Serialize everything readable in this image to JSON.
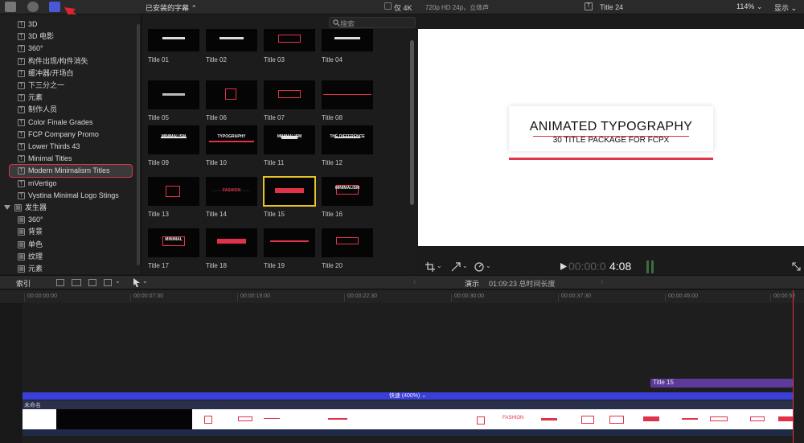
{
  "browser_header": {
    "title": "已安装的字幕 ⌃",
    "only4k": "仅 4K",
    "search_placeholder": "搜索"
  },
  "sidebar": {
    "items": [
      {
        "label": "3D"
      },
      {
        "label": "3D 电影"
      },
      {
        "label": "360°"
      },
      {
        "label": "构件出现/构件消失"
      },
      {
        "label": "缓冲器/开场白"
      },
      {
        "label": "下三分之一"
      },
      {
        "label": "元素"
      },
      {
        "label": "制作人员"
      },
      {
        "label": "Color Finale Grades"
      },
      {
        "label": "FCP Company Promo"
      },
      {
        "label": "Lower Thirds 43"
      },
      {
        "label": "Minimal Titles"
      },
      {
        "label": "Modern Minimalism Titles"
      },
      {
        "label": "mVertigo"
      },
      {
        "label": "Vystina Minimal Logo Stings"
      }
    ],
    "generator_group": "发生器",
    "generator_items": [
      {
        "label": "360°"
      },
      {
        "label": "背景"
      },
      {
        "label": "单色"
      },
      {
        "label": "纹理"
      },
      {
        "label": "元素"
      }
    ]
  },
  "thumbnails": [
    {
      "label": "Title 01"
    },
    {
      "label": "Title 02"
    },
    {
      "label": "Title 03"
    },
    {
      "label": "Title 04"
    },
    {
      "label": "Title 05"
    },
    {
      "label": "Title 06"
    },
    {
      "label": "Title 07"
    },
    {
      "label": "Title 08"
    },
    {
      "label": "Title 09"
    },
    {
      "label": "Title 10"
    },
    {
      "label": "Title 11"
    },
    {
      "label": "Title 12"
    },
    {
      "label": "Title 13"
    },
    {
      "label": "Title 14"
    },
    {
      "label": "Title 15"
    },
    {
      "label": "Title 16"
    },
    {
      "label": "Title 17"
    },
    {
      "label": "Title 18"
    },
    {
      "label": "Title 19"
    },
    {
      "label": "Title 20"
    }
  ],
  "thumb_text": {
    "t09": "MINIMALISM",
    "t10": "TYPOGRAPHY",
    "t11": "MINIMALISM",
    "t12": "THE DIFFERENCE",
    "t16": "MINIMALISM",
    "t14": "FASHION",
    "t17": "MINIMAL"
  },
  "viewer": {
    "format": "720p HD 24p，立体声",
    "clip_name": "Title 24",
    "zoom": "114% ⌄",
    "display": "显示 ⌄",
    "canvas_title": "ANIMATED TYPOGRAPHY",
    "canvas_subtitle": "30 TITLE PACKAGE FOR FCPX",
    "timecode_dim": "00:00:0",
    "timecode_bright": "4:08"
  },
  "toolbar": {
    "index": "索引",
    "project": "演示",
    "duration": "01:09:23 总时间长度"
  },
  "ruler": [
    "00:00:00:00",
    "00:00:07:30",
    "00:00:15:00",
    "00:00:22:30",
    "00:00:30:00",
    "00:00:37:30",
    "00:00:45:00",
    "00:00:52"
  ],
  "timeline": {
    "title_clip": "Title 15",
    "speed_bar": "快速 (400%) ⌄",
    "primary_name": "未命名",
    "filmstrip_fashion": "FASHION"
  },
  "colors": {
    "accent_red": "#e0334a",
    "selection_yellow": "#e8c229",
    "speed_blue": "#3b3fd9",
    "title_clip_purple": "#5b3a9a"
  }
}
